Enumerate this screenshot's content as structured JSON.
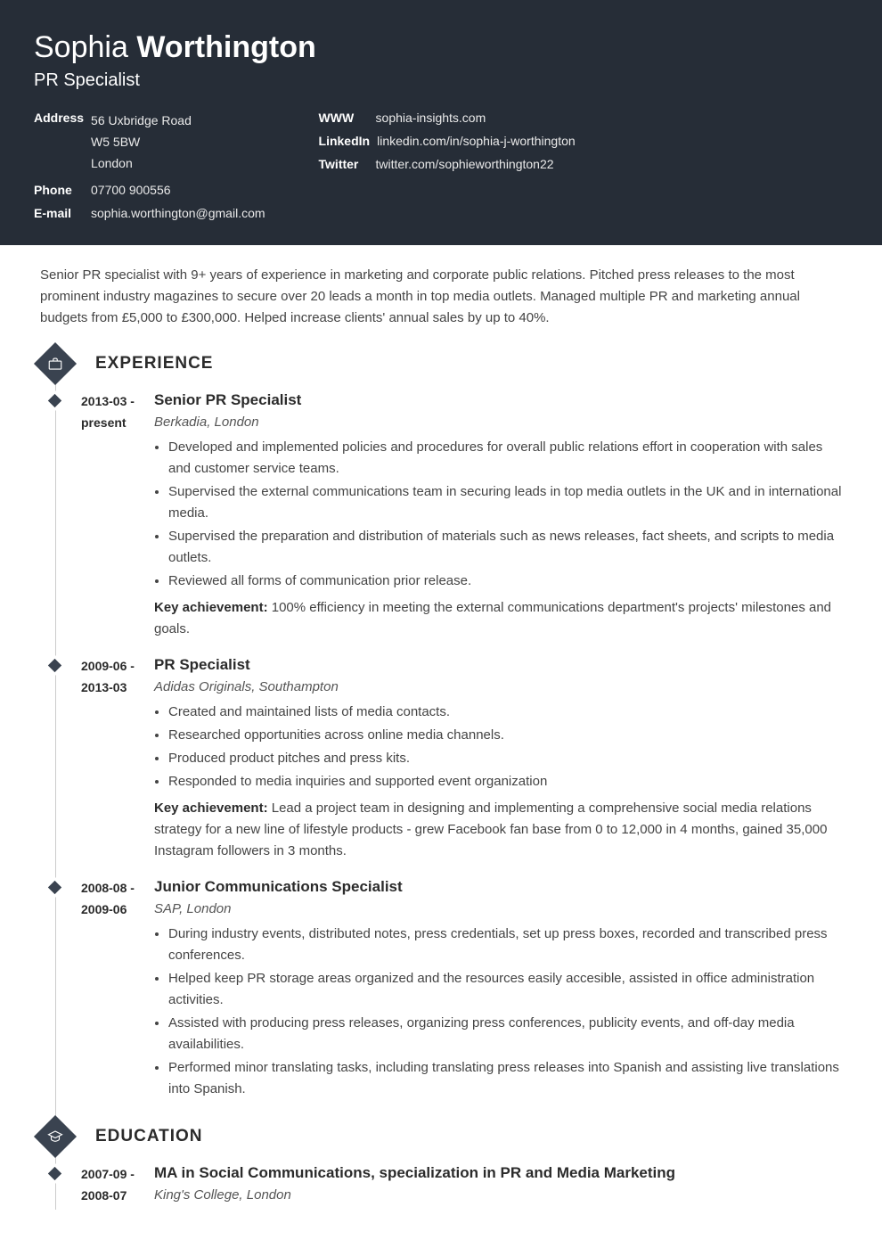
{
  "name_first": "Sophia",
  "name_last": "Worthington",
  "title": "PR Specialist",
  "contact_left": {
    "address_label": "Address",
    "address_lines": [
      "56 Uxbridge Road",
      "W5 5BW",
      "London"
    ],
    "phone_label": "Phone",
    "phone": "07700 900556",
    "email_label": "E-mail",
    "email": "sophia.worthington@gmail.com"
  },
  "contact_right": {
    "www_label": "WWW",
    "www": "sophia-insights.com",
    "linkedin_label": "LinkedIn",
    "linkedin": "linkedin.com/in/sophia-j-worthington",
    "twitter_label": "Twitter",
    "twitter": "twitter.com/sophieworthington22"
  },
  "summary": "Senior PR specialist with 9+ years of experience in marketing and corporate public relations. Pitched press releases to the most prominent industry magazines to secure over 20 leads a month in top media outlets. Managed multiple PR and marketing annual budgets from £5,000 to £300,000. Helped increase clients' annual sales by up to 40%.",
  "sections": {
    "experience_title": "EXPERIENCE",
    "education_title": "EDUCATION"
  },
  "experience": [
    {
      "dates": "2013-03 - present",
      "title": "Senior PR Specialist",
      "sub": "Berkadia, London",
      "bullets": [
        "Developed and implemented policies and procedures for overall public relations effort in cooperation with sales and customer service teams.",
        "Supervised the external communications team in securing leads in top media outlets in the UK and in international media.",
        "Supervised the preparation and distribution of materials such as news releases, fact sheets, and scripts to media outlets.",
        "Reviewed all forms of communication prior release."
      ],
      "ka_label": "Key achievement:",
      "ka_text": " 100% efficiency in meeting the external communications department's projects' milestones and goals."
    },
    {
      "dates": "2009-06 - 2013-03",
      "title": "PR Specialist",
      "sub": "Adidas Originals, Southampton",
      "bullets": [
        "Created and maintained lists of media contacts.",
        "Researched opportunities across online media channels.",
        "Produced product pitches and press kits.",
        "Responded to media inquiries and supported event organization"
      ],
      "ka_label": "Key achievement:",
      "ka_text": " Lead a project team in designing and implementing a comprehensive social media relations strategy for a new line of lifestyle products - grew Facebook fan base from 0 to 12,000 in 4 months, gained 35,000 Instagram followers in 3 months."
    },
    {
      "dates": "2008-08 - 2009-06",
      "title": "Junior Communications Specialist",
      "sub": "SAP, London",
      "bullets": [
        "During industry events, distributed notes, press credentials, set up press boxes, recorded and transcribed press conferences.",
        "Helped keep PR storage areas organized and the resources easily accesible, assisted in office administration activities.",
        "Assisted with producing press releases, organizing press conferences, publicity events, and off-day media availabilities.",
        "Performed minor translating tasks, including translating press releases into Spanish and assisting live translations into Spanish."
      ],
      "ka_label": "",
      "ka_text": ""
    }
  ],
  "education": [
    {
      "dates": "2007-09 - 2008-07",
      "title": "MA in Social Communications, specialization in PR and Media Marketing",
      "sub": "King's College, London"
    }
  ]
}
